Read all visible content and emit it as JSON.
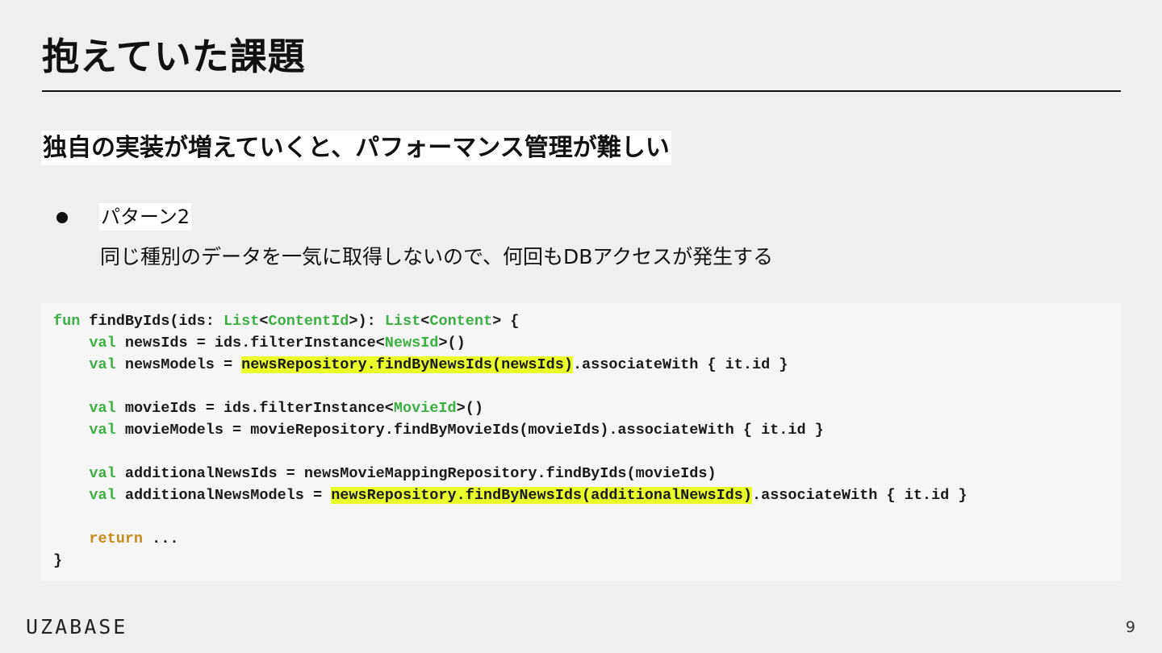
{
  "slide": {
    "title": "抱えていた課題",
    "subtitle": "独自の実装が増えていくと、パフォーマンス管理が難しい",
    "bullet": {
      "label": "パターン2",
      "description": "同じ種別のデータを一気に取得しないので、何回もDBアクセスが発生する"
    },
    "logo": "UZABASE",
    "page_number": "9"
  },
  "code": {
    "lines": [
      [
        {
          "t": "fun",
          "c": "kw"
        },
        {
          "t": " findByIds(ids: "
        },
        {
          "t": "List",
          "c": "kw"
        },
        {
          "t": "<"
        },
        {
          "t": "ContentId",
          "c": "kw"
        },
        {
          "t": ">): "
        },
        {
          "t": "List",
          "c": "kw"
        },
        {
          "t": "<"
        },
        {
          "t": "Content",
          "c": "kw"
        },
        {
          "t": "> {"
        }
      ],
      [
        {
          "t": "    "
        },
        {
          "t": "val",
          "c": "kw"
        },
        {
          "t": " newsIds = ids.filterInstance<"
        },
        {
          "t": "NewsId",
          "c": "kw"
        },
        {
          "t": ">()"
        }
      ],
      [
        {
          "t": "    "
        },
        {
          "t": "val",
          "c": "kw"
        },
        {
          "t": " newsModels = "
        },
        {
          "t": "newsRepository.findByNewsIds(newsIds)",
          "c": "hl"
        },
        {
          "t": ".associateWith { it.id }"
        }
      ],
      [],
      [
        {
          "t": "    "
        },
        {
          "t": "val",
          "c": "kw"
        },
        {
          "t": " movieIds = ids.filterInstance<"
        },
        {
          "t": "MovieId",
          "c": "kw"
        },
        {
          "t": ">()"
        }
      ],
      [
        {
          "t": "    "
        },
        {
          "t": "val",
          "c": "kw"
        },
        {
          "t": " movieModels = movieRepository.findByMovieIds(movieIds).associateWith { it.id }"
        }
      ],
      [],
      [
        {
          "t": "    "
        },
        {
          "t": "val",
          "c": "kw"
        },
        {
          "t": " additionalNewsIds = newsMovieMappingRepository.findByIds(movieIds)"
        }
      ],
      [
        {
          "t": "    "
        },
        {
          "t": "val",
          "c": "kw"
        },
        {
          "t": " additionalNewsModels = "
        },
        {
          "t": "newsRepository.findByNewsIds(additionalNewsIds)",
          "c": "hl"
        },
        {
          "t": ".associateWith { it.id }"
        }
      ],
      [],
      [
        {
          "t": "    "
        },
        {
          "t": "return",
          "c": "ret"
        },
        {
          "t": " ..."
        }
      ],
      [
        {
          "t": "}"
        }
      ]
    ],
    "colors": {
      "keyword": "#3cb043",
      "return": "#c98a1b",
      "highlight": "#eaff2a"
    }
  }
}
